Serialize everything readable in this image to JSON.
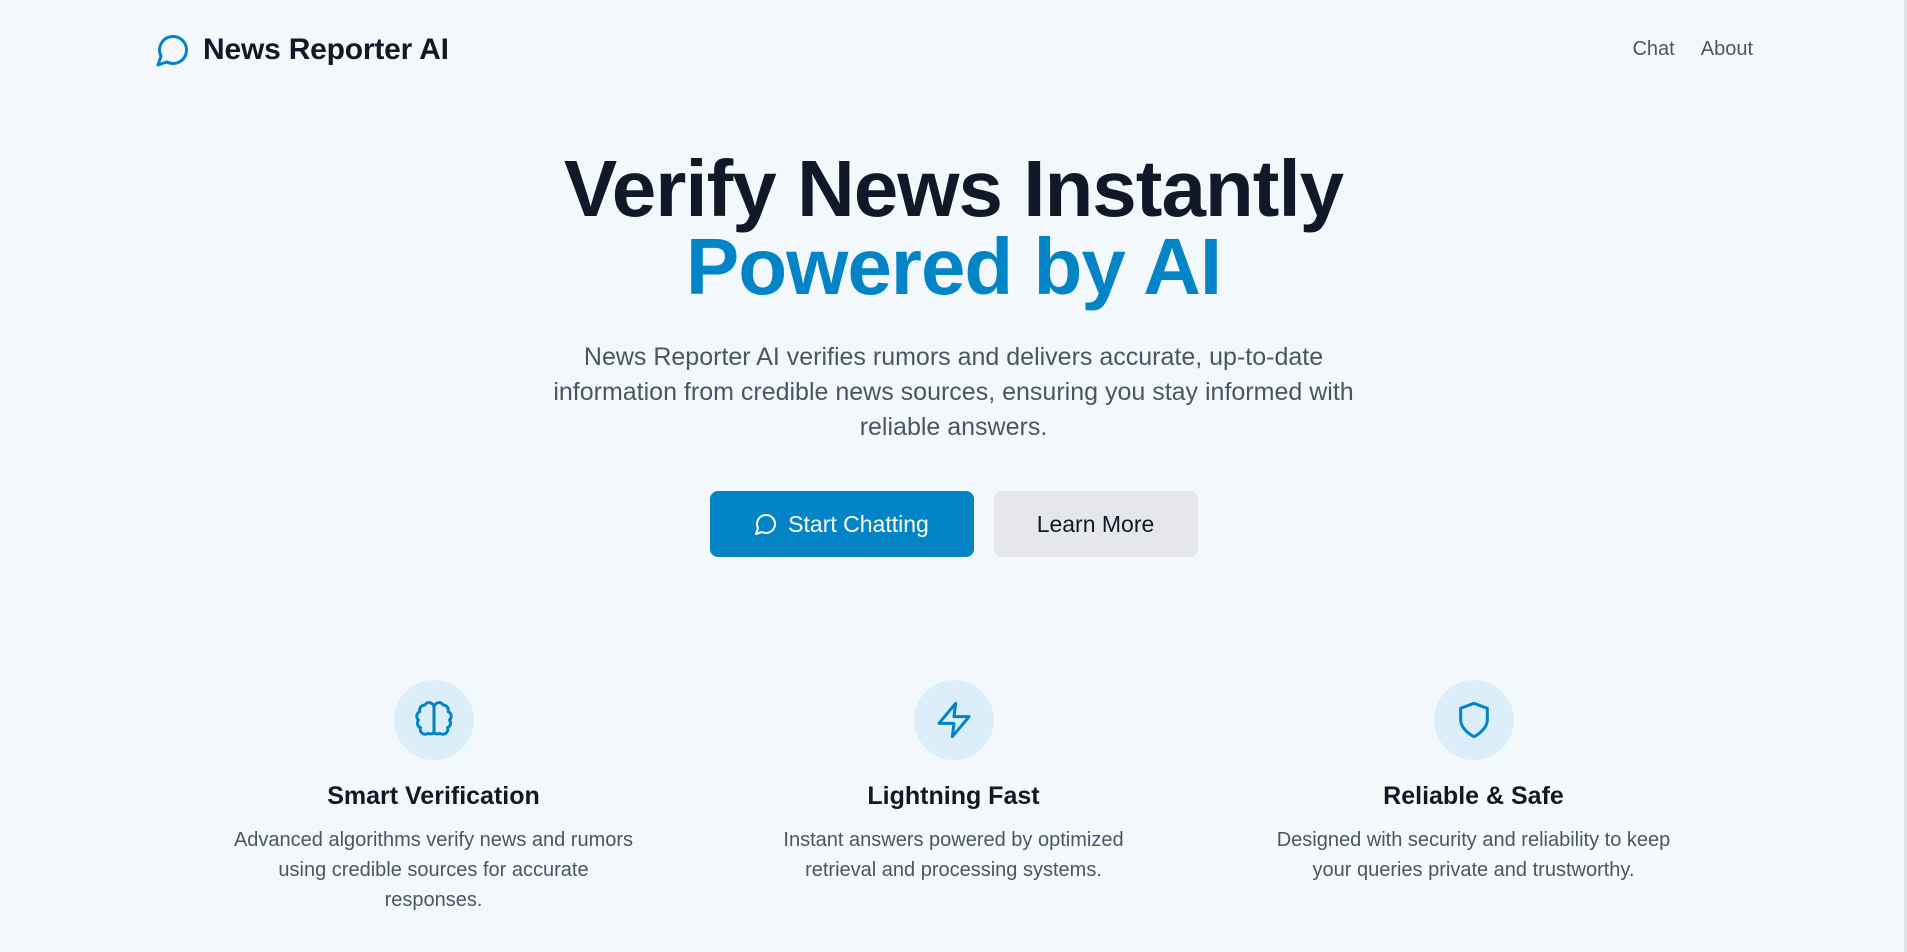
{
  "brand": {
    "name": "News Reporter AI",
    "icon": "chat-bubble-icon"
  },
  "nav": {
    "items": [
      {
        "label": "Chat"
      },
      {
        "label": "About"
      }
    ]
  },
  "hero": {
    "title_line1": "Verify News Instantly",
    "title_line2": "Powered by AI",
    "description": "News Reporter AI verifies rumors and delivers accurate, up-to-date information from credible news sources, ensuring you stay informed with reliable answers.",
    "primary_cta": "Start Chatting",
    "secondary_cta": "Learn More"
  },
  "features": [
    {
      "icon": "brain-icon",
      "title": "Smart Verification",
      "description": "Advanced algorithms verify news and rumors using credible sources for accurate responses."
    },
    {
      "icon": "lightning-icon",
      "title": "Lightning Fast",
      "description": "Instant answers powered by optimized retrieval and processing systems."
    },
    {
      "icon": "shield-icon",
      "title": "Reliable & Safe",
      "description": "Designed with security and reliability to keep your queries private and trustworthy."
    }
  ],
  "colors": {
    "accent": "#0284c7",
    "heading": "#111827",
    "body_text": "#4b5563",
    "secondary_button": "#e5e7eb",
    "icon_bg": "#dbeefa"
  }
}
